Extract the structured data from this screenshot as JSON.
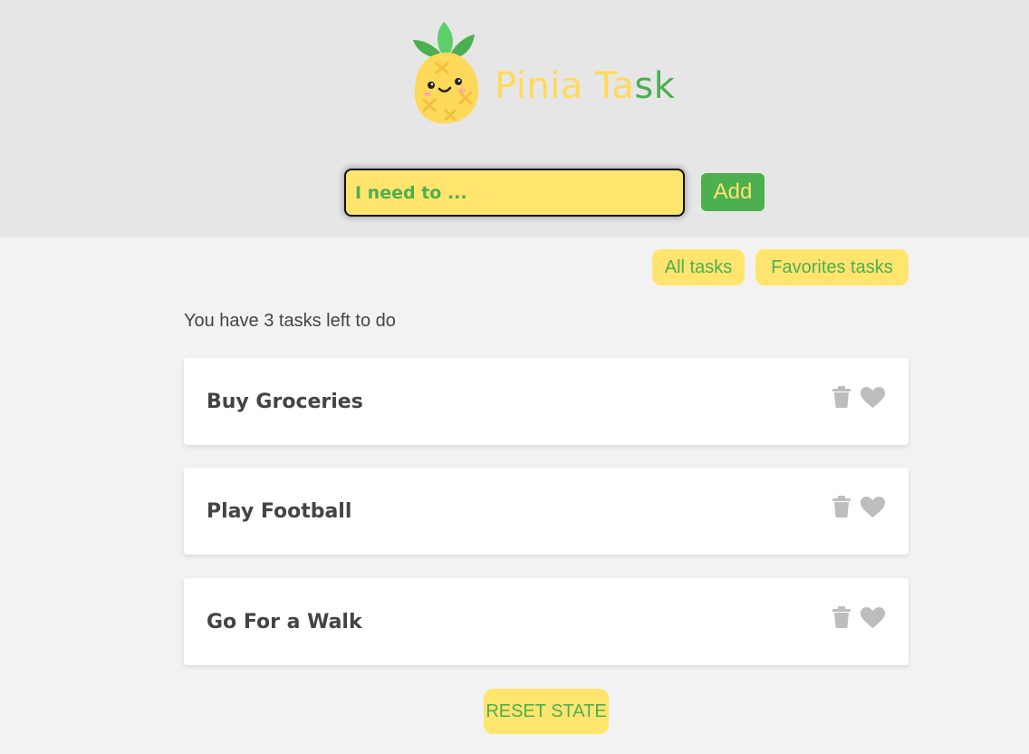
{
  "header": {
    "title_part1": "Pinia Ta",
    "title_part2": "sk",
    "logo_icon": "pineapple-icon"
  },
  "form": {
    "input_value": "",
    "input_placeholder": "I need to ...",
    "add_label": "Add"
  },
  "filters": {
    "all_label": "All tasks",
    "favorites_label": "Favorites tasks"
  },
  "summary": {
    "tasks_left_text": "You have 3 tasks left to do"
  },
  "tasks": [
    {
      "title": "Buy Groceries",
      "icons": [
        "trash-icon",
        "heart-icon"
      ]
    },
    {
      "title": "Play Football",
      "icons": [
        "trash-icon",
        "heart-icon"
      ]
    },
    {
      "title": "Go For a Walk",
      "icons": [
        "trash-icon",
        "heart-icon"
      ]
    }
  ],
  "reset": {
    "label": "RESET STATE"
  },
  "colors": {
    "accent_yellow": "#ffe46e",
    "accent_green": "#4caf50",
    "header_bg": "#e6e6e6",
    "body_bg": "#f2f2f2",
    "icon_gray": "#bdbdbd"
  }
}
